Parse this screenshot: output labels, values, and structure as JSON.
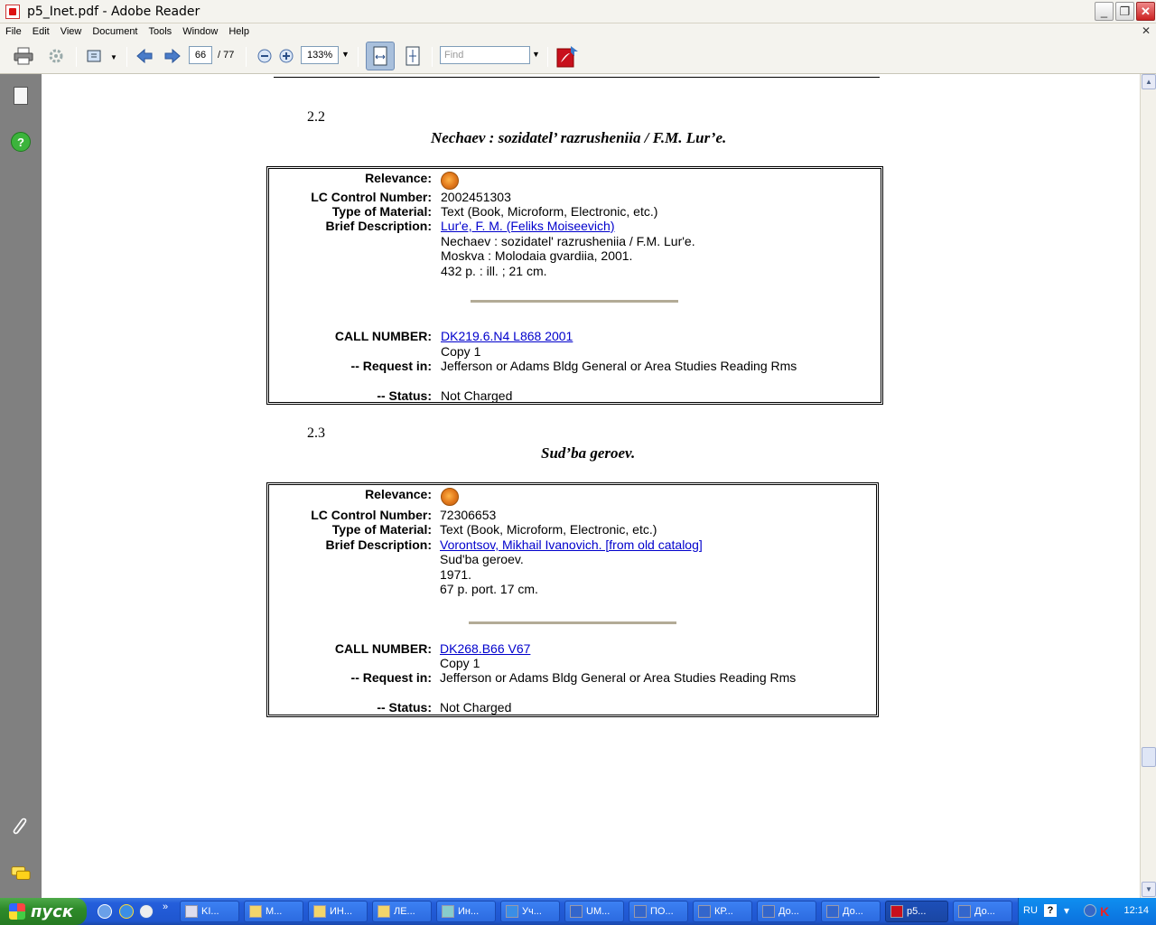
{
  "window": {
    "title": "p5_Inet.pdf - Adobe Reader"
  },
  "menu": {
    "items": [
      "File",
      "Edit",
      "View",
      "Document",
      "Tools",
      "Window",
      "Help"
    ]
  },
  "toolbar": {
    "page_current": "66",
    "page_total": "/ 77",
    "zoom": "133%",
    "find_placeholder": "Find"
  },
  "records": [
    {
      "section": "2.2",
      "title": "Nechaev : sozidatel’ razrusheniia / F.M. Lur’e.",
      "labels": {
        "relevance": "Relevance:",
        "lccn": "LC Control Number:",
        "type": "Type of Material:",
        "brief": "Brief Description:",
        "call": "CALL NUMBER:",
        "request": "-- Request in:",
        "status": "-- Status:"
      },
      "lccn": "2002451303",
      "type": "Text (Book, Microform, Electronic, etc.)",
      "author_link": "Lur'e, F. M. (Feliks Moiseevich)",
      "desc_lines": [
        "Nechaev : sozidatel' razrusheniia / F.M. Lur'e.",
        "Moskva : Molodaia gvardiia, 2001.",
        "432 p. : ill. ; 21 cm."
      ],
      "call_number": "DK219.6.N4 L868 2001",
      "copy": "Copy 1",
      "request_in": "Jefferson or Adams Bldg General or Area Studies Reading Rms",
      "status": "Not Charged"
    },
    {
      "section": "2.3",
      "title": "Sud’ba geroev.",
      "labels": {
        "relevance": "Relevance:",
        "lccn": "LC Control Number:",
        "type": "Type of Material:",
        "brief": "Brief Description:",
        "call": "CALL NUMBER:",
        "request": "-- Request in:",
        "status": "-- Status:"
      },
      "lccn": "72306653",
      "type": "Text (Book, Microform, Electronic, etc.)",
      "author_link": "Vorontsov, Mikhail Ivanovich. [from old catalog]",
      "desc_lines": [
        "Sud'ba geroev.",
        "1971.",
        "67 p. port. 17 cm."
      ],
      "call_number": "DK268.B66 V67",
      "copy": "Copy 1",
      "request_in": "Jefferson or Adams Bldg General or Area Studies Reading Rms",
      "status": "Not Charged"
    }
  ],
  "taskbar": {
    "start": "пуск",
    "tasks": [
      "KI...",
      "M...",
      "ИН...",
      "ЛЕ...",
      "Ин...",
      "Уч...",
      "UM...",
      "ПО...",
      "КР...",
      "До...",
      "До...",
      "p5...",
      "До..."
    ],
    "lang": "RU",
    "clock": "12:14"
  }
}
